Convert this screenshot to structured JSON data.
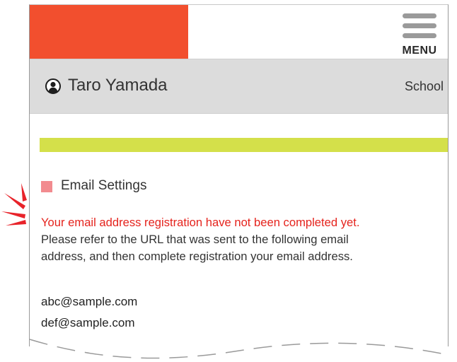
{
  "colors": {
    "brand_block": "#f24f2e",
    "menu_icon": "#9a9a9a",
    "user_bar_bg": "#dcdcdc",
    "progress_bar": "#d4e04a",
    "section_marker": "#f28b8f",
    "warning_text": "#e5231d",
    "alert_marks": "#e8232a"
  },
  "header": {
    "menu_label": "MENU",
    "menu_icon": "hamburger-menu-icon"
  },
  "user_bar": {
    "user_icon": "user-circle-icon",
    "user_name": "Taro Yamada",
    "school_link": "School"
  },
  "progress": {
    "fill_fraction": 1.0
  },
  "email_settings": {
    "heading": "Email Settings",
    "warning": "Your email address registration have not been completed yet.",
    "instructions": [
      "Please refer to the URL that was sent to the following email",
      "address, and then complete registration your email address."
    ],
    "emails": [
      "abc@sample.com",
      "def@sample.com"
    ]
  },
  "annotations": {
    "alert_icon": "alert-burst-icon"
  }
}
